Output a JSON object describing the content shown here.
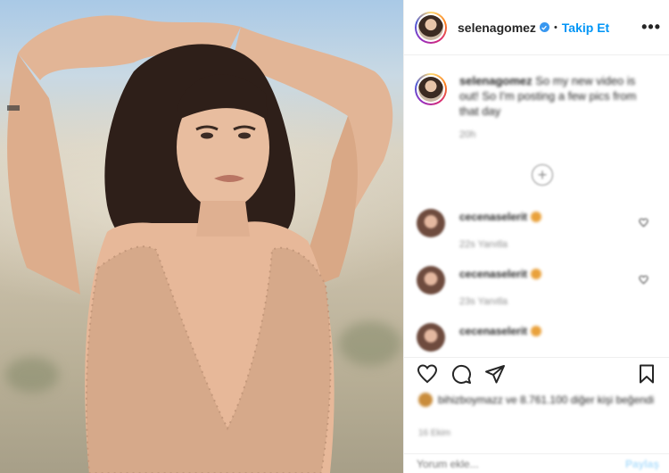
{
  "header": {
    "username": "selenagomez",
    "separator": "•",
    "follow_label": "Takip Et",
    "more_label": "•••"
  },
  "caption": {
    "username": "selenagomez",
    "text": "So my new video is out! So I'm posting a few pics from that day",
    "time_ago": "20h"
  },
  "load_more_symbol": "+",
  "comments": [
    {
      "username": "cecenaselerit",
      "meta": "22s  Yanıtla"
    },
    {
      "username": "cecenaselerit",
      "meta": "23s  Yanıtla"
    },
    {
      "username": "cecenaselerit",
      "meta": ""
    }
  ],
  "likes": {
    "text": "bihizboymazz ve 8.761.100 diğer kişi beğendi"
  },
  "date": "16 Ekim",
  "add_comment": {
    "placeholder": "Yorum ekle...",
    "post_label": "Paylaş"
  },
  "icons": [
    "more-icon",
    "verified-icon",
    "plus-circle-icon",
    "heart-icon",
    "comment-icon",
    "share-icon",
    "bookmark-icon"
  ],
  "colors": {
    "accent": "#0095f6",
    "verified": "#3897f0",
    "text": "#262626",
    "muted": "#8e8e8e"
  }
}
